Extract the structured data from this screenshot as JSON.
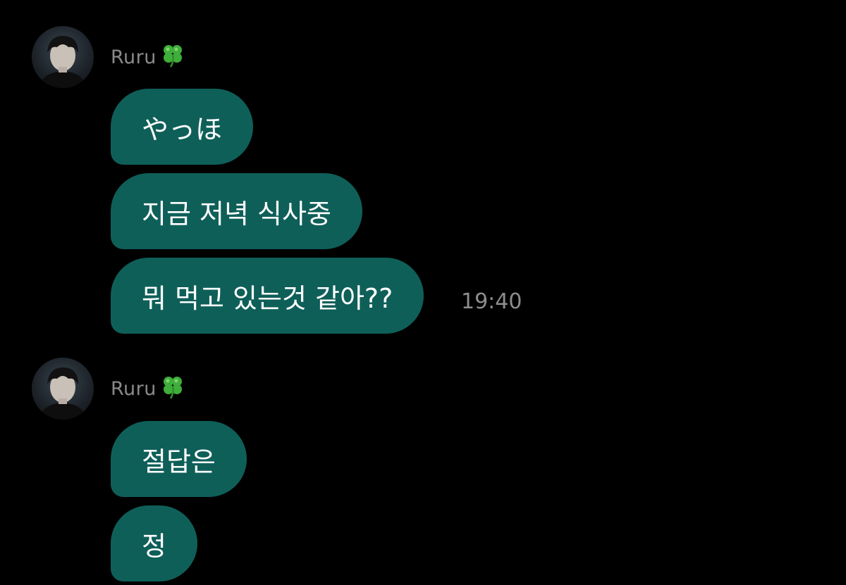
{
  "groups": [
    {
      "sender": {
        "name": "Ruru",
        "badge_icon": "four-leaf-clover-icon"
      },
      "messages": [
        {
          "text": "やっほ"
        },
        {
          "text": "지금 저녁 식사중"
        },
        {
          "text": "뭐 먹고 있는것 같아??"
        }
      ],
      "timestamp": "19:40"
    },
    {
      "sender": {
        "name": "Ruru",
        "badge_icon": "four-leaf-clover-icon"
      },
      "messages": [
        {
          "text": "절답은"
        },
        {
          "text": "정"
        }
      ]
    }
  ],
  "colors": {
    "background": "#000000",
    "bubble": "#0f5f59",
    "bubble_text": "#ffffff",
    "sender_name": "#8a8a8a",
    "timestamp": "#8d8d8d",
    "clover": "#3fae3a"
  }
}
